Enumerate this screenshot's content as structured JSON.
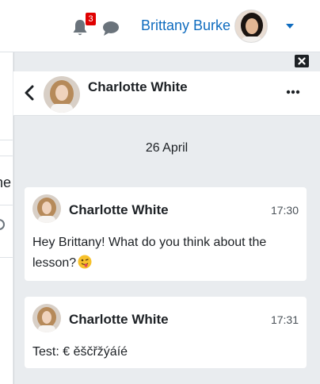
{
  "navbar": {
    "notification_count": "3",
    "user_name": "Brittany Burke"
  },
  "conversation": {
    "contact_name": "Charlotte White",
    "date_separator": "26 April",
    "messages": [
      {
        "sender": "Charlotte White",
        "time": "17:30",
        "text": "Hey Brittany! What do you think about the lesson?",
        "emoji": "wink-tongue-emoji"
      },
      {
        "sender": "Charlotte White",
        "time": "17:31",
        "text": "Test: € ěščřžýáíé"
      }
    ]
  },
  "left_page": {
    "text_fragment": "ne"
  },
  "colors": {
    "accent": "#0f6cbf",
    "badge": "#e00000",
    "background": "#e9ecef"
  }
}
